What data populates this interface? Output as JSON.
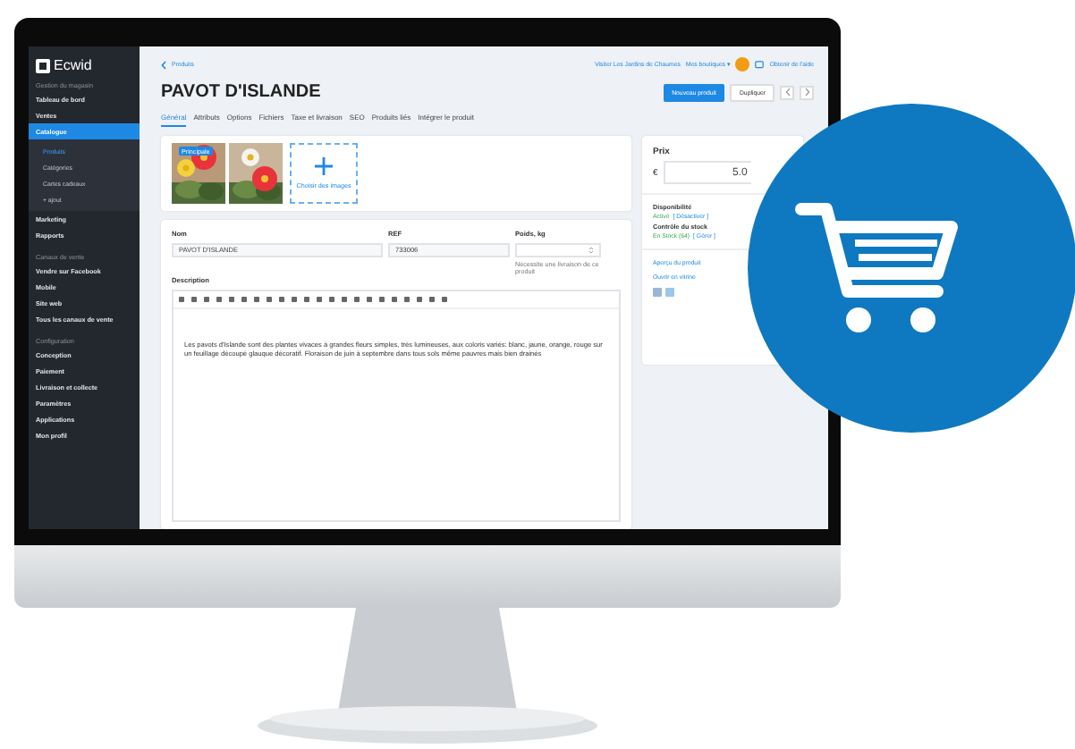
{
  "sidebar": {
    "logo": "Ecwid",
    "sections": [
      {
        "heading": "Gestion du magasin",
        "items": [
          {
            "label": "Tableau de bord",
            "selected": false
          },
          {
            "label": "Ventes",
            "selected": false
          },
          {
            "label": "Catalogue",
            "selected": true,
            "children": [
              {
                "label": "Produits",
                "selected": true
              },
              {
                "label": "Catégories",
                "selected": false
              },
              {
                "label": "Cartes cadeaux",
                "selected": false
              },
              {
                "label": "+ ajout",
                "selected": false
              }
            ]
          },
          {
            "label": "Marketing",
            "selected": false
          },
          {
            "label": "Rapports",
            "selected": false
          }
        ]
      },
      {
        "heading": "Canaux de vente",
        "items": [
          {
            "label": "Vendre sur Facebook",
            "selected": false
          },
          {
            "label": "Mobile",
            "selected": false
          },
          {
            "label": "Site web",
            "selected": false
          },
          {
            "label": "Tous les canaux de vente",
            "selected": false
          }
        ]
      },
      {
        "heading": "Configuration",
        "items": [
          {
            "label": "Conception",
            "selected": false
          },
          {
            "label": "Paiement",
            "selected": false
          },
          {
            "label": "Livraison et collecte",
            "selected": false
          },
          {
            "label": "Paramètres",
            "selected": false
          },
          {
            "label": "Applications",
            "selected": false
          },
          {
            "label": "Mon profil",
            "selected": false
          }
        ]
      }
    ]
  },
  "topbar": {
    "back": "Produits",
    "links": [
      "Visiter Les Jardins de Chaumes",
      "Mes boutiques ▾"
    ],
    "help": "Obtenir de l'aide"
  },
  "title": "PAVOT D'ISLANDE",
  "buttons": [
    {
      "label": "Nouveau produit",
      "kind": "primary"
    },
    {
      "label": "Dupliquer",
      "kind": "secondary"
    }
  ],
  "tabs": [
    {
      "label": "Général",
      "selected": true
    },
    {
      "label": "Attributs",
      "selected": false
    },
    {
      "label": "Options",
      "selected": false
    },
    {
      "label": "Fichiers",
      "selected": false
    },
    {
      "label": "Taxe et livraison",
      "selected": false
    },
    {
      "label": "SEO",
      "selected": false
    },
    {
      "label": "Produits liés",
      "selected": false
    },
    {
      "label": "Intégrer le produit",
      "selected": false
    }
  ],
  "images": [
    {
      "kind": "picture",
      "badge": "Principale"
    },
    {
      "kind": "picture"
    }
  ],
  "add_image": "Choisir des images",
  "fields": [
    {
      "label": "Nom",
      "value": "PAVOT D'ISLANDE"
    },
    {
      "label": "REF",
      "value": "733006"
    },
    {
      "label": "Poids, kg",
      "hint": "Nécessite une livraison de ce produit"
    }
  ],
  "description": {
    "label": "Description",
    "text": "Les pavots d'Islande sont des plantes vivaces à grandes fleurs simples, très lumineuses, aux coloris variés: blanc, jaune, orange, rouge sur un feuillage découpé glauque décoratif. Floraison de juin à septembre dans tous sols même pauvres mais bien drainés"
  },
  "price": {
    "label": "Prix",
    "currency": "€",
    "value": "5.0"
  },
  "availability": {
    "label": "Disponibilité",
    "status": "Activé",
    "action": "[ Désactiver ]"
  },
  "stock": {
    "label": "Contrôle du stock",
    "status": "En Stock (64)",
    "action": "[ Gérer ]"
  },
  "links": [
    "Aperçu du produit",
    "Ouvrir en vitrine"
  ]
}
